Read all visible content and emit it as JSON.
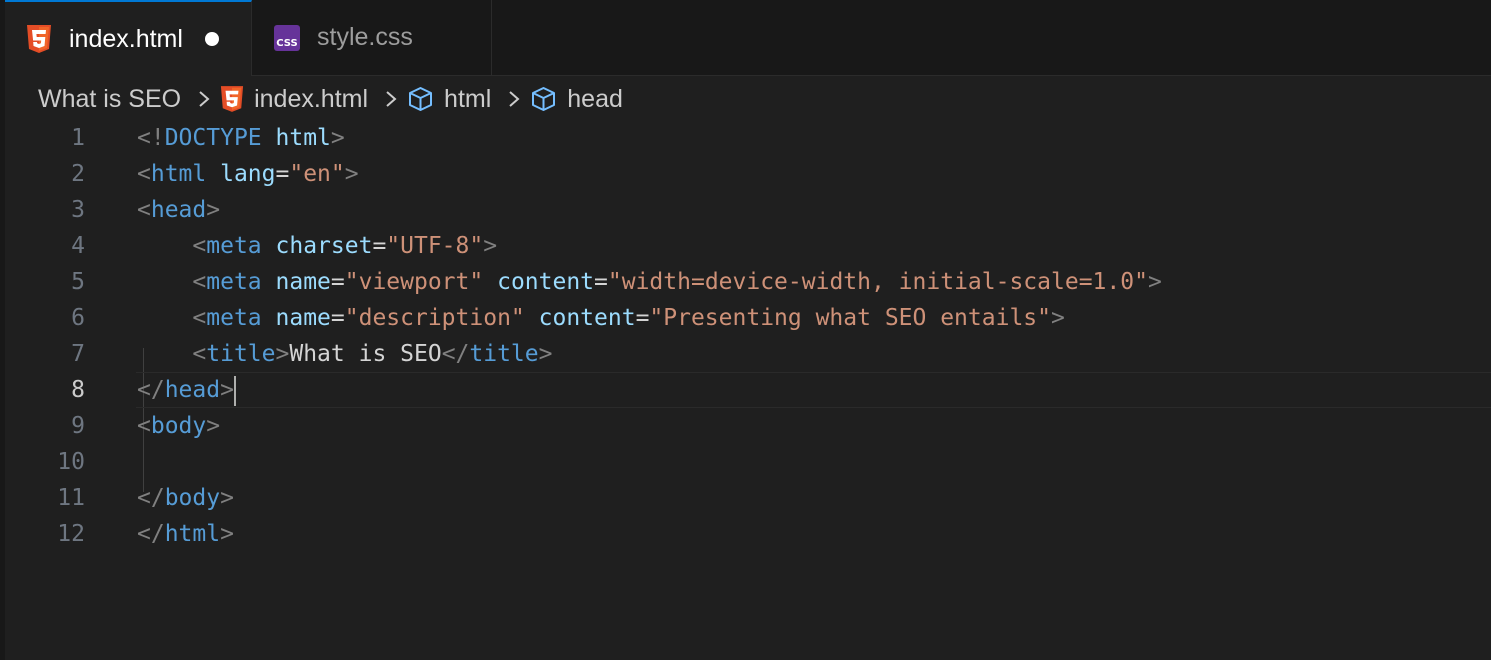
{
  "tabs": [
    {
      "label": "index.html",
      "icon": "html5-icon",
      "active": true,
      "unsaved": true
    },
    {
      "label": "style.css",
      "icon": "css-icon",
      "active": false
    }
  ],
  "breadcrumb": {
    "folder": "What is SEO",
    "file": "index.html",
    "symbols": [
      "html",
      "head"
    ]
  },
  "editor": {
    "current_line": 8,
    "line_numbers": [
      "1",
      "2",
      "3",
      "4",
      "5",
      "6",
      "7",
      "8",
      "9",
      "10",
      "11",
      "12"
    ],
    "lines": [
      "<!DOCTYPE html>",
      "<html lang=\"en\">",
      "<head>",
      "    <meta charset=\"UTF-8\">",
      "    <meta name=\"viewport\" content=\"width=device-width, initial-scale=1.0\">",
      "    <meta name=\"description\" content=\"Presenting what SEO entails\">",
      "    <title>What is SEO</title>",
      "</head>",
      "<body>",
      "",
      "</body>",
      "</html>"
    ]
  },
  "colors": {
    "background": "#1f1f1f",
    "tag": "#569cd6",
    "attribute": "#9cdcfe",
    "string": "#ce9178",
    "punctuation": "#808080",
    "text": "#d4d4d4",
    "html5_icon": "#e44d26",
    "css_icon": "#663399",
    "active_tab_accent": "#0078d4"
  }
}
